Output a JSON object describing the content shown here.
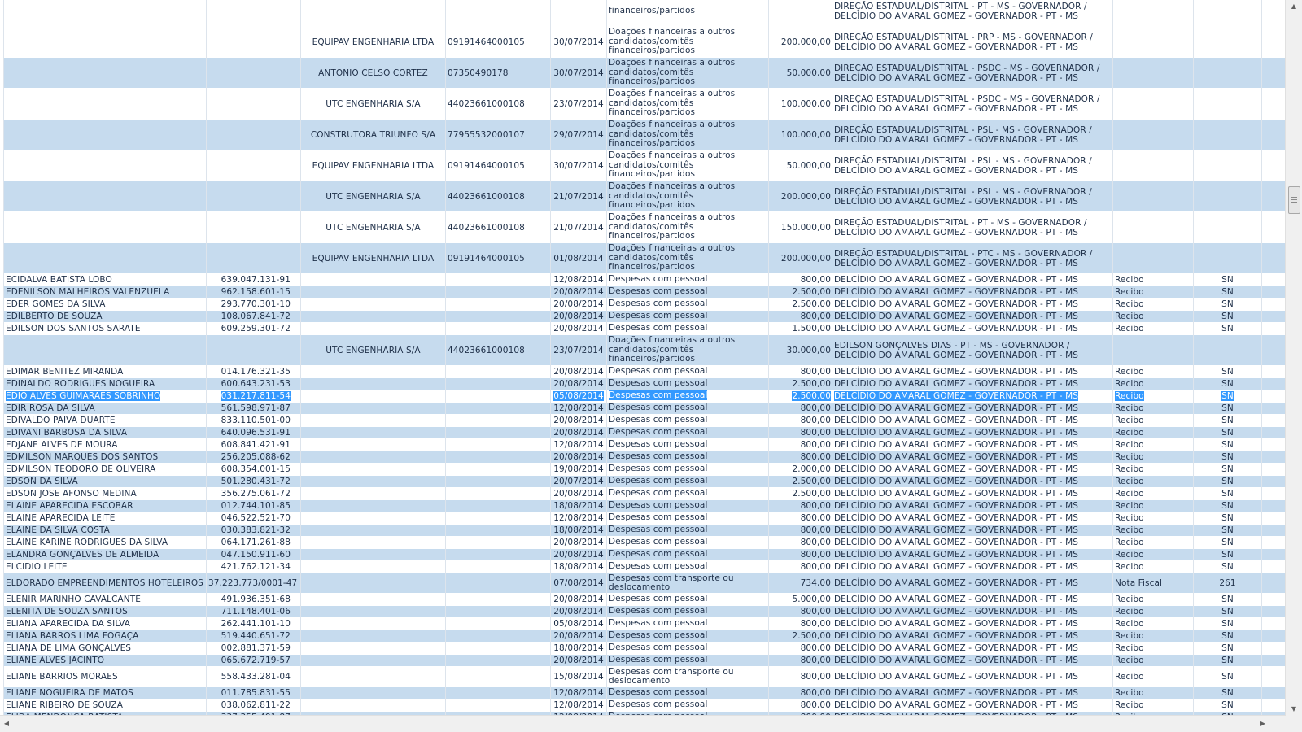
{
  "table": {
    "rows": [
      {
        "kind": "tall",
        "alt": false,
        "name": "",
        "doc": "",
        "donor": "",
        "cnpj": "",
        "date": "",
        "desc": "financeiros/partidos",
        "value": "",
        "dest": "DIREÇÃO ESTADUAL/DISTRITAL - PT - MS - GOVERNADOR / DELCÍDIO DO AMARAL GOMEZ - GOVERNADOR - PT - MS",
        "type": "",
        "num": ""
      },
      {
        "kind": "tall",
        "alt": false,
        "name": "",
        "doc": "",
        "donor": "EQUIPAV ENGENHARIA LTDA",
        "cnpj": "09191464000105",
        "date": "30/07/2014",
        "desc": "Doações financeiras a outros candidatos/comitês financeiros/partidos",
        "value": "200.000,00",
        "dest": "DIREÇÃO ESTADUAL/DISTRITAL - PRP - MS - GOVERNADOR / DELCÍDIO DO AMARAL GOMEZ - GOVERNADOR - PT - MS",
        "type": "",
        "num": ""
      },
      {
        "kind": "tall",
        "alt": true,
        "name": "",
        "doc": "",
        "donor": "ANTONIO CELSO CORTEZ",
        "cnpj": "07350490178",
        "date": "30/07/2014",
        "desc": "Doações financeiras a outros candidatos/comitês financeiros/partidos",
        "value": "50.000,00",
        "dest": "DIREÇÃO ESTADUAL/DISTRITAL - PSDC - MS - GOVERNADOR / DELCÍDIO DO AMARAL GOMEZ - GOVERNADOR - PT - MS",
        "type": "",
        "num": ""
      },
      {
        "kind": "tall",
        "alt": false,
        "name": "",
        "doc": "",
        "donor": "UTC ENGENHARIA S/A",
        "cnpj": "44023661000108",
        "date": "23/07/2014",
        "desc": "Doações financeiras a outros candidatos/comitês financeiros/partidos",
        "value": "100.000,00",
        "dest": "DIREÇÃO ESTADUAL/DISTRITAL - PSDC - MS - GOVERNADOR / DELCÍDIO DO AMARAL GOMEZ - GOVERNADOR - PT - MS",
        "type": "",
        "num": ""
      },
      {
        "kind": "tall",
        "alt": true,
        "name": "",
        "doc": "",
        "donor": "CONSTRUTORA TRIUNFO S/A",
        "cnpj": "77955532000107",
        "date": "29/07/2014",
        "desc": "Doações financeiras a outros candidatos/comitês financeiros/partidos",
        "value": "100.000,00",
        "dest": "DIREÇÃO ESTADUAL/DISTRITAL - PSL - MS - GOVERNADOR / DELCÍDIO DO AMARAL GOMEZ - GOVERNADOR - PT - MS",
        "type": "",
        "num": ""
      },
      {
        "kind": "tall",
        "alt": false,
        "name": "",
        "doc": "",
        "donor": "EQUIPAV ENGENHARIA LTDA",
        "cnpj": "09191464000105",
        "date": "30/07/2014",
        "desc": "Doações financeiras a outros candidatos/comitês financeiros/partidos",
        "value": "50.000,00",
        "dest": "DIREÇÃO ESTADUAL/DISTRITAL - PSL - MS - GOVERNADOR / DELCÍDIO DO AMARAL GOMEZ - GOVERNADOR - PT - MS",
        "type": "",
        "num": ""
      },
      {
        "kind": "tall",
        "alt": true,
        "name": "",
        "doc": "",
        "donor": "UTC ENGENHARIA S/A",
        "cnpj": "44023661000108",
        "date": "21/07/2014",
        "desc": "Doações financeiras a outros candidatos/comitês financeiros/partidos",
        "value": "200.000,00",
        "dest": "DIREÇÃO ESTADUAL/DISTRITAL - PSL - MS - GOVERNADOR / DELCÍDIO DO AMARAL GOMEZ - GOVERNADOR - PT - MS",
        "type": "",
        "num": ""
      },
      {
        "kind": "tall",
        "alt": false,
        "name": "",
        "doc": "",
        "donor": "UTC ENGENHARIA S/A",
        "cnpj": "44023661000108",
        "date": "21/07/2014",
        "desc": "Doações financeiras a outros candidatos/comitês financeiros/partidos",
        "value": "150.000,00",
        "dest": "DIREÇÃO ESTADUAL/DISTRITAL - PT - MS - GOVERNADOR / DELCÍDIO DO AMARAL GOMEZ - GOVERNADOR - PT - MS",
        "type": "",
        "num": ""
      },
      {
        "kind": "tall",
        "alt": true,
        "name": "",
        "doc": "",
        "donor": "EQUIPAV ENGENHARIA LTDA",
        "cnpj": "09191464000105",
        "date": "01/08/2014",
        "desc": "Doações financeiras a outros candidatos/comitês financeiros/partidos",
        "value": "200.000,00",
        "dest": "DIREÇÃO ESTADUAL/DISTRITAL - PTC - MS - GOVERNADOR / DELCÍDIO DO AMARAL GOMEZ - GOVERNADOR - PT - MS",
        "type": "",
        "num": ""
      },
      {
        "kind": "single",
        "alt": false,
        "name": "ECIDALVA BATISTA LOBO",
        "doc": "639.047.131-91",
        "donor": "",
        "cnpj": "",
        "date": "12/08/2014",
        "desc": "Despesas com pessoal",
        "value": "800,00",
        "dest": "DELCÍDIO DO AMARAL GOMEZ - GOVERNADOR - PT - MS",
        "type": "Recibo",
        "num": "SN"
      },
      {
        "kind": "single",
        "alt": true,
        "name": "EDENILSON MALHEIROS VALENZUELA",
        "doc": "962.158.601-15",
        "donor": "",
        "cnpj": "",
        "date": "20/08/2014",
        "desc": "Despesas com pessoal",
        "value": "2.500,00",
        "dest": "DELCÍDIO DO AMARAL GOMEZ - GOVERNADOR - PT - MS",
        "type": "Recibo",
        "num": "SN"
      },
      {
        "kind": "single",
        "alt": false,
        "name": "EDER GOMES DA SILVA",
        "doc": "293.770.301-10",
        "donor": "",
        "cnpj": "",
        "date": "20/08/2014",
        "desc": "Despesas com pessoal",
        "value": "2.500,00",
        "dest": "DELCÍDIO DO AMARAL GOMEZ - GOVERNADOR - PT - MS",
        "type": "Recibo",
        "num": "SN"
      },
      {
        "kind": "single",
        "alt": true,
        "name": "EDILBERTO DE SOUZA",
        "doc": "108.067.841-72",
        "donor": "",
        "cnpj": "",
        "date": "20/08/2014",
        "desc": "Despesas com pessoal",
        "value": "800,00",
        "dest": "DELCÍDIO DO AMARAL GOMEZ - GOVERNADOR - PT - MS",
        "type": "Recibo",
        "num": "SN"
      },
      {
        "kind": "single",
        "alt": false,
        "name": "EDILSON DOS SANTOS SARATE",
        "doc": "609.259.301-72",
        "donor": "",
        "cnpj": "",
        "date": "20/08/2014",
        "desc": "Despesas com pessoal",
        "value": "1.500,00",
        "dest": "DELCÍDIO DO AMARAL GOMEZ - GOVERNADOR - PT - MS",
        "type": "Recibo",
        "num": "SN"
      },
      {
        "kind": "tall",
        "alt": true,
        "name": "",
        "doc": "",
        "donor": "UTC ENGENHARIA S/A",
        "cnpj": "44023661000108",
        "date": "23/07/2014",
        "desc": "Doações financeiras a outros candidatos/comitês financeiros/partidos",
        "value": "30.000,00",
        "dest": "EDILSON GONÇALVES DIAS - PT - MS - GOVERNADOR / DELCÍDIO DO AMARAL GOMEZ - GOVERNADOR - PT - MS",
        "type": "",
        "num": ""
      },
      {
        "kind": "single",
        "alt": false,
        "name": "EDIMAR BENITEZ MIRANDA",
        "doc": "014.176.321-35",
        "donor": "",
        "cnpj": "",
        "date": "20/08/2014",
        "desc": "Despesas com pessoal",
        "value": "800,00",
        "dest": "DELCÍDIO DO AMARAL GOMEZ - GOVERNADOR - PT - MS",
        "type": "Recibo",
        "num": "SN"
      },
      {
        "kind": "single",
        "alt": true,
        "name": "EDINALDO RODRIGUES NOGUEIRA",
        "doc": "600.643.231-53",
        "donor": "",
        "cnpj": "",
        "date": "20/08/2014",
        "desc": "Despesas com pessoal",
        "value": "2.500,00",
        "dest": "DELCÍDIO DO AMARAL GOMEZ - GOVERNADOR - PT - MS",
        "type": "Recibo",
        "num": "SN"
      },
      {
        "kind": "single",
        "alt": false,
        "sel": true,
        "name": "EDIO ALVES GUIMARAES SOBRINHO",
        "doc": "031.217.811-54",
        "donor": "",
        "cnpj": "",
        "date": "05/08/2014",
        "desc": "Despesas com pessoal",
        "value": "2.500,00",
        "dest": "DELCÍDIO DO AMARAL GOMEZ - GOVERNADOR - PT - MS",
        "type": "Recibo",
        "num": "SN"
      },
      {
        "kind": "single",
        "alt": true,
        "name": "EDIR ROSA DA SILVA",
        "doc": "561.598.971-87",
        "donor": "",
        "cnpj": "",
        "date": "12/08/2014",
        "desc": "Despesas com pessoal",
        "value": "800,00",
        "dest": "DELCÍDIO DO AMARAL GOMEZ - GOVERNADOR - PT - MS",
        "type": "Recibo",
        "num": "SN"
      },
      {
        "kind": "single",
        "alt": false,
        "name": "EDIVALDO PAIVA DUARTE",
        "doc": "833.110.501-00",
        "donor": "",
        "cnpj": "",
        "date": "20/08/2014",
        "desc": "Despesas com pessoal",
        "value": "800,00",
        "dest": "DELCÍDIO DO AMARAL GOMEZ - GOVERNADOR - PT - MS",
        "type": "Recibo",
        "num": "SN"
      },
      {
        "kind": "single",
        "alt": true,
        "name": "EDIVANI BARBOSA DA SILVA",
        "doc": "640.096.531-91",
        "donor": "",
        "cnpj": "",
        "date": "20/08/2014",
        "desc": "Despesas com pessoal",
        "value": "800,00",
        "dest": "DELCÍDIO DO AMARAL GOMEZ - GOVERNADOR - PT - MS",
        "type": "Recibo",
        "num": "SN"
      },
      {
        "kind": "single",
        "alt": false,
        "name": "EDJANE ALVES DE MOURA",
        "doc": "608.841.421-91",
        "donor": "",
        "cnpj": "",
        "date": "12/08/2014",
        "desc": "Despesas com pessoal",
        "value": "800,00",
        "dest": "DELCÍDIO DO AMARAL GOMEZ - GOVERNADOR - PT - MS",
        "type": "Recibo",
        "num": "SN"
      },
      {
        "kind": "single",
        "alt": true,
        "name": "EDMILSON MARQUES DOS SANTOS",
        "doc": "256.205.088-62",
        "donor": "",
        "cnpj": "",
        "date": "20/08/2014",
        "desc": "Despesas com pessoal",
        "value": "800,00",
        "dest": "DELCÍDIO DO AMARAL GOMEZ - GOVERNADOR - PT - MS",
        "type": "Recibo",
        "num": "SN"
      },
      {
        "kind": "single",
        "alt": false,
        "name": "EDMILSON TEODORO DE OLIVEIRA",
        "doc": "608.354.001-15",
        "donor": "",
        "cnpj": "",
        "date": "19/08/2014",
        "desc": "Despesas com pessoal",
        "value": "2.000,00",
        "dest": "DELCÍDIO DO AMARAL GOMEZ - GOVERNADOR - PT - MS",
        "type": "Recibo",
        "num": "SN"
      },
      {
        "kind": "single",
        "alt": true,
        "name": "EDSON DA SILVA",
        "doc": "501.280.431-72",
        "donor": "",
        "cnpj": "",
        "date": "20/07/2014",
        "desc": "Despesas com pessoal",
        "value": "2.500,00",
        "dest": "DELCÍDIO DO AMARAL GOMEZ - GOVERNADOR - PT - MS",
        "type": "Recibo",
        "num": "SN"
      },
      {
        "kind": "single",
        "alt": false,
        "name": "EDSON JOSE AFONSO MEDINA",
        "doc": "356.275.061-72",
        "donor": "",
        "cnpj": "",
        "date": "20/08/2014",
        "desc": "Despesas com pessoal",
        "value": "2.500,00",
        "dest": "DELCÍDIO DO AMARAL GOMEZ - GOVERNADOR - PT - MS",
        "type": "Recibo",
        "num": "SN"
      },
      {
        "kind": "single",
        "alt": true,
        "name": "ELAINE APARECIDA ESCOBAR",
        "doc": "012.744.101-85",
        "donor": "",
        "cnpj": "",
        "date": "18/08/2014",
        "desc": "Despesas com pessoal",
        "value": "800,00",
        "dest": "DELCÍDIO DO AMARAL GOMEZ - GOVERNADOR - PT - MS",
        "type": "Recibo",
        "num": "SN"
      },
      {
        "kind": "single",
        "alt": false,
        "name": "ELAINE APARECIDA LEITE",
        "doc": "046.522.521-70",
        "donor": "",
        "cnpj": "",
        "date": "12/08/2014",
        "desc": "Despesas com pessoal",
        "value": "800,00",
        "dest": "DELCÍDIO DO AMARAL GOMEZ - GOVERNADOR - PT - MS",
        "type": "Recibo",
        "num": "SN"
      },
      {
        "kind": "single",
        "alt": true,
        "name": "ELAINE DA SILVA COSTA",
        "doc": "030.383.821-32",
        "donor": "",
        "cnpj": "",
        "date": "18/08/2014",
        "desc": "Despesas com pessoal",
        "value": "800,00",
        "dest": "DELCÍDIO DO AMARAL GOMEZ - GOVERNADOR - PT - MS",
        "type": "Recibo",
        "num": "SN"
      },
      {
        "kind": "single",
        "alt": false,
        "name": "ELAINE KARINE RODRIGUES DA SILVA",
        "doc": "064.171.261-88",
        "donor": "",
        "cnpj": "",
        "date": "20/08/2014",
        "desc": "Despesas com pessoal",
        "value": "800,00",
        "dest": "DELCÍDIO DO AMARAL GOMEZ - GOVERNADOR - PT - MS",
        "type": "Recibo",
        "num": "SN"
      },
      {
        "kind": "single",
        "alt": true,
        "name": "ELANDRA GONÇALVES DE ALMEIDA",
        "doc": "047.150.911-60",
        "donor": "",
        "cnpj": "",
        "date": "20/08/2014",
        "desc": "Despesas com pessoal",
        "value": "800,00",
        "dest": "DELCÍDIO DO AMARAL GOMEZ - GOVERNADOR - PT - MS",
        "type": "Recibo",
        "num": "SN"
      },
      {
        "kind": "single",
        "alt": false,
        "name": "ELCIDIO LEITE",
        "doc": "421.762.121-34",
        "donor": "",
        "cnpj": "",
        "date": "18/08/2014",
        "desc": "Despesas com pessoal",
        "value": "800,00",
        "dest": "DELCÍDIO DO AMARAL GOMEZ - GOVERNADOR - PT - MS",
        "type": "Recibo",
        "num": "SN"
      },
      {
        "kind": "two",
        "alt": true,
        "name": "ELDORADO EMPREENDIMENTOS HOTELEIROS E TURISTICOS LTDA ME",
        "doc": "37.223.773/0001-47",
        "donor": "",
        "cnpj": "",
        "date": "07/08/2014",
        "desc": "Despesas com transporte ou deslocamento",
        "value": "734,00",
        "dest": "DELCÍDIO DO AMARAL GOMEZ - GOVERNADOR - PT - MS",
        "type": "Nota Fiscal",
        "num": "261"
      },
      {
        "kind": "single",
        "alt": false,
        "name": "ELENIR MARINHO CAVALCANTE",
        "doc": "491.936.351-68",
        "donor": "",
        "cnpj": "",
        "date": "20/08/2014",
        "desc": "Despesas com pessoal",
        "value": "5.000,00",
        "dest": "DELCÍDIO DO AMARAL GOMEZ - GOVERNADOR - PT - MS",
        "type": "Recibo",
        "num": "SN"
      },
      {
        "kind": "single",
        "alt": true,
        "name": "ELENITA DE SOUZA SANTOS",
        "doc": "711.148.401-06",
        "donor": "",
        "cnpj": "",
        "date": "20/08/2014",
        "desc": "Despesas com pessoal",
        "value": "800,00",
        "dest": "DELCÍDIO DO AMARAL GOMEZ - GOVERNADOR - PT - MS",
        "type": "Recibo",
        "num": "SN"
      },
      {
        "kind": "single",
        "alt": false,
        "name": "ELIANA APARECIDA DA SILVA",
        "doc": "262.441.101-10",
        "donor": "",
        "cnpj": "",
        "date": "05/08/2014",
        "desc": "Despesas com pessoal",
        "value": "800,00",
        "dest": "DELCÍDIO DO AMARAL GOMEZ - GOVERNADOR - PT - MS",
        "type": "Recibo",
        "num": "SN"
      },
      {
        "kind": "single",
        "alt": true,
        "name": "ELIANA BARROS LIMA FOGAÇA",
        "doc": "519.440.651-72",
        "donor": "",
        "cnpj": "",
        "date": "20/08/2014",
        "desc": "Despesas com pessoal",
        "value": "2.500,00",
        "dest": "DELCÍDIO DO AMARAL GOMEZ - GOVERNADOR - PT - MS",
        "type": "Recibo",
        "num": "SN"
      },
      {
        "kind": "single",
        "alt": false,
        "name": "ELIANA DE LIMA GONÇALVES",
        "doc": "002.881.371-59",
        "donor": "",
        "cnpj": "",
        "date": "18/08/2014",
        "desc": "Despesas com pessoal",
        "value": "800,00",
        "dest": "DELCÍDIO DO AMARAL GOMEZ - GOVERNADOR - PT - MS",
        "type": "Recibo",
        "num": "SN"
      },
      {
        "kind": "single",
        "alt": true,
        "name": "ELIANE ALVES JACINTO",
        "doc": "065.672.719-57",
        "donor": "",
        "cnpj": "",
        "date": "20/08/2014",
        "desc": "Despesas com pessoal",
        "value": "800,00",
        "dest": "DELCÍDIO DO AMARAL GOMEZ - GOVERNADOR - PT - MS",
        "type": "Recibo",
        "num": "SN"
      },
      {
        "kind": "two",
        "alt": false,
        "name": "ELIANE BARRIOS MORAES",
        "doc": "558.433.281-04",
        "donor": "",
        "cnpj": "",
        "date": "15/08/2014",
        "desc": "Despesas com transporte ou deslocamento",
        "value": "800,00",
        "dest": "DELCÍDIO DO AMARAL GOMEZ - GOVERNADOR - PT - MS",
        "type": "Recibo",
        "num": "SN"
      },
      {
        "kind": "single",
        "alt": true,
        "name": "ELIANE NOGUEIRA DE MATOS",
        "doc": "011.785.831-55",
        "donor": "",
        "cnpj": "",
        "date": "12/08/2014",
        "desc": "Despesas com pessoal",
        "value": "800,00",
        "dest": "DELCÍDIO DO AMARAL GOMEZ - GOVERNADOR - PT - MS",
        "type": "Recibo",
        "num": "SN"
      },
      {
        "kind": "single",
        "alt": false,
        "name": "ELIANE RIBEIRO DE SOUZA",
        "doc": "038.062.811-22",
        "donor": "",
        "cnpj": "",
        "date": "12/08/2014",
        "desc": "Despesas com pessoal",
        "value": "800,00",
        "dest": "DELCÍDIO DO AMARAL GOMEZ - GOVERNADOR - PT - MS",
        "type": "Recibo",
        "num": "SN"
      },
      {
        "kind": "single",
        "alt": true,
        "name": "ELIDA MENDONÇA BATISTA",
        "doc": "337.355.491-87",
        "donor": "",
        "cnpj": "",
        "date": "12/08/2014",
        "desc": "Despesas com pessoal",
        "value": "800,00",
        "dest": "DELCÍDIO DO AMARAL GOMEZ - GOVERNADOR - PT - MS",
        "type": "Recibo",
        "num": "SN"
      }
    ]
  },
  "scrollbars": {
    "up_icon": "arrow-up-icon",
    "down_icon": "arrow-down-icon",
    "left_icon": "arrow-left-icon",
    "right_icon": "arrow-right-icon"
  }
}
